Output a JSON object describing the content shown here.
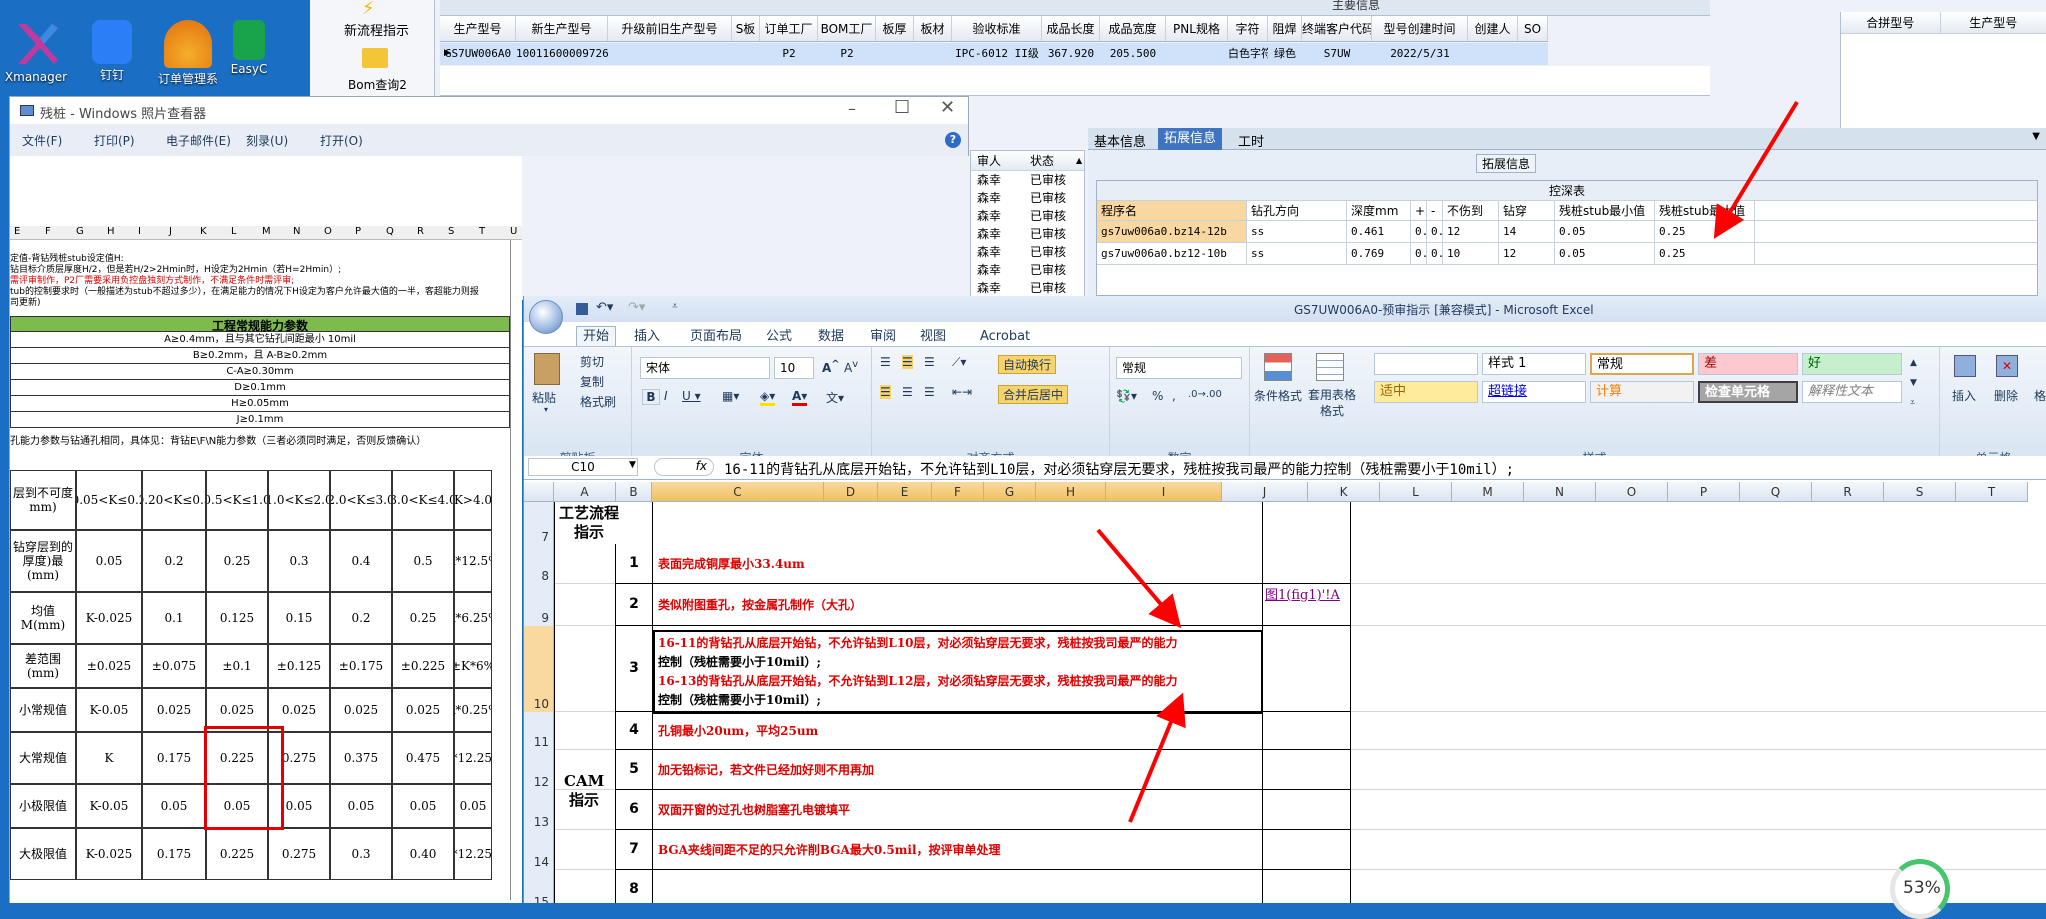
{
  "desktop": {
    "icons": [
      {
        "label": "Xmanager"
      },
      {
        "label": "钉钉"
      },
      {
        "label": "订单管理系"
      },
      {
        "label": "EasyC"
      }
    ],
    "top_labels": [
      "…"
    ]
  },
  "erp": {
    "left_buttons": [
      {
        "label": "新流程指示"
      },
      {
        "label": "Bom查询2"
      }
    ],
    "header_title": "主要信息",
    "columns": [
      "生产型号",
      "新生产型号",
      "升级前旧生产型号",
      "S板",
      "订单工厂",
      "BOM工厂",
      "板厚",
      "板材",
      "验收标准",
      "成品长度",
      "成品宽度",
      "PNL规格",
      "字符",
      "阻焊",
      "终端客户代码",
      "型号创建时间",
      "创建人",
      "SO"
    ],
    "row": [
      "GS7UW006A0",
      "10011600009726",
      "",
      "",
      "P2",
      "P2",
      "",
      "",
      "IPC-6012 II级",
      "367.920",
      "205.500",
      "",
      "白色字符",
      "绿色",
      "S7UW",
      "2022/5/31",
      "",
      ""
    ],
    "right_cols": [
      "合拼型号",
      "生产型号"
    ],
    "side_col_headers": [
      "审人",
      "状态"
    ],
    "side_rows": [
      [
        "森幸",
        "已审核"
      ],
      [
        "森幸",
        "已审核"
      ],
      [
        "森幸",
        "已审核"
      ],
      [
        "森幸",
        "已审核"
      ],
      [
        "森幸",
        "已审核"
      ],
      [
        "森幸",
        "已审核"
      ],
      [
        "森幸",
        "已审核"
      ]
    ],
    "tabs": [
      "基本信息",
      "拓展信息",
      "工时"
    ],
    "group_title": "拓展信息",
    "table_title": "控深表",
    "depth_cols": [
      "程序名",
      "钻孔方向",
      "深度mm",
      "+",
      "-",
      "不伤到",
      "钻穿",
      "残桩stub最小值",
      "残桩stub最大值"
    ],
    "depth_rows": [
      [
        "gs7uw006a0.bz14-12b",
        "ss",
        "0.461",
        "0..",
        "0..",
        "12",
        "14",
        "0.05",
        "0.25"
      ],
      [
        "gs7uw006a0.bz12-10b",
        "ss",
        "0.769",
        "0..",
        "0..",
        "10",
        "12",
        "0.05",
        "0.25"
      ]
    ]
  },
  "photo_viewer": {
    "title": "残桩 - Windows 照片查看器",
    "menu": [
      "文件(F)",
      "打印(P)",
      "电子邮件(E)",
      "刻录(U)",
      "打开(O)"
    ],
    "col_letters": [
      "E",
      "F",
      "G",
      "H",
      "I",
      "J",
      "K",
      "L",
      "M",
      "N",
      "O",
      "P",
      "Q",
      "R",
      "S",
      "T",
      "U"
    ],
    "notes": [
      "定值-背钻残桩stub设定值H:",
      "钻目标介质层厚度H/2，但是若H/2>2Hmin时，H设定为2Hmin（若H=2Hmin）;",
      "需评审制作，P2厂需要采用负控盘独刻方式制作，不满足条件时需评审;",
      "tub的控制要求时（一般描述为stub不超过多少），在满足能力的情况下H设定为客户允许最大值的一半，客超能力则报",
      "司更新)"
    ],
    "cap_title": "工程常规能力参数",
    "cap_rows": [
      "A≥0.4mm，且与其它钻孔间距最小 10mil",
      "B≥0.2mm，且 A-B≥0.2mm",
      "C-A≥0.30mm",
      "D≥0.1mm",
      "H≥0.05mm",
      "J≥0.1mm"
    ],
    "cap_note": "孔能力参数与钻通孔相同，具体见：背钻E\\F\\N能力参数（三者必须同时满足，否则反馈确认）",
    "k_headers": [
      "层到不可度mm)",
      "0.05<K≤0.2",
      "0.20<K≤0.5",
      "0.5<K≤1.0",
      "1.0<K≤2.0",
      "2.0<K≤3.0",
      "3.0<K≤4.0",
      "K>4.0"
    ],
    "k_rows": [
      [
        "钻穿层到的厚度)最(mm)",
        "0.05",
        "0.2",
        "0.25",
        "0.3",
        "0.4",
        "0.5",
        "K*12.5%"
      ],
      [
        "均值M(mm)",
        "K-0.025",
        "0.1",
        "0.125",
        "0.15",
        "0.2",
        "0.25",
        "K*6.25%"
      ],
      [
        "差范围(mm)",
        "±0.025",
        "±0.075",
        "±0.1",
        "±0.125",
        "±0.175",
        "±0.225",
        "±K*6%"
      ],
      [
        "小常规值",
        "K-0.05",
        "0.025",
        "0.025",
        "0.025",
        "0.025",
        "0.025",
        "K*0.25%"
      ],
      [
        "大常规值",
        "K",
        "0.175",
        "0.225",
        "0.275",
        "0.375",
        "0.475",
        "K*12.25%"
      ],
      [
        "小极限值",
        "K-0.05",
        "0.05",
        "0.05",
        "0.05",
        "0.05",
        "0.05",
        "0.05"
      ],
      [
        "大极限值",
        "K-0.025",
        "0.175",
        "0.225",
        "0.275",
        "0.3",
        "0.40",
        "K*12.25%"
      ]
    ]
  },
  "excel": {
    "title": "GS7UW006A0-预审指示  [兼容模式] - Microsoft Excel",
    "tabs": [
      "开始",
      "插入",
      "页面布局",
      "公式",
      "数据",
      "审阅",
      "视图",
      "Acrobat"
    ],
    "clipboard": {
      "paste": "粘贴",
      "cut": "剪切",
      "copy": "复制",
      "format_painter": "格式刷",
      "label": "剪贴板"
    },
    "font": {
      "name": "宋体",
      "size": "10",
      "label": "字体"
    },
    "align": {
      "wrap": "自动换行",
      "merge": "合并后居中",
      "label": "对齐方式"
    },
    "number": {
      "format": "常规",
      "label": "数字"
    },
    "styles": {
      "cond": "条件格式",
      "table": "套用表格格式",
      "label": "样式",
      "cells": [
        "",
        "样式 1",
        "常规",
        "差",
        "好",
        "适中",
        "超链接",
        "计算",
        "检查单元格",
        "解释性文本"
      ]
    },
    "cells_group": {
      "insert": "插入",
      "delete": "删除",
      "format": "格式",
      "label": "单元格"
    },
    "name_box": "C10",
    "formula": "16-11的背钻孔从底层开始钻，不允许钻到L10层，对必须钻穿层无要求，残桩按我司最严的能力控制（残桩需要小于10mil）;",
    "columns": [
      "A",
      "B",
      "C",
      "D",
      "E",
      "F",
      "G",
      "H",
      "I",
      "J",
      "K",
      "L",
      "M",
      "N",
      "O",
      "P",
      "Q",
      "R",
      "S",
      "T"
    ],
    "a7": "工艺流程指示",
    "a_cam": "CAM指示",
    "rows": [
      {
        "rn": "8",
        "num": "1",
        "text": "表面完成铜厚最小33.4um"
      },
      {
        "rn": "9",
        "num": "2",
        "text": "类似附图重孔，按金属孔制作（大孔）",
        "link": "图1(fig1)'!A"
      },
      {
        "rn": "10",
        "num": "3",
        "lines": [
          "16-11的背钻孔从底层开始钻，不允许钻到L10层，对必须钻穿层无要求，残桩按我司最严的能力",
          "控制（残桩需要小于10mil）;",
          "16-13的背钻孔从底层开始钻，不允许钻到L12层，对必须钻穿层无要求，残桩按我司最严的能力",
          "控制（残桩需要小于10mil）;"
        ]
      },
      {
        "rn": "11",
        "num": "4",
        "text": "孔铜最小20um，平均25um"
      },
      {
        "rn": "12",
        "num": "5",
        "text": "加无铅标记，若文件已经加好则不用再加"
      },
      {
        "rn": "13",
        "num": "6",
        "text": "双面开窗的过孔也树脂塞孔电镀填平"
      },
      {
        "rn": "14",
        "num": "7",
        "text": "BGA夹线间距不足的只允许削BGA最大0.5mil，按评审单处理"
      },
      {
        "rn": "15",
        "num": "8",
        "text": ""
      }
    ],
    "row7": "7",
    "progress": "53%"
  },
  "colors": {
    "accent_red": "#ff0000",
    "excel_blue": "#1e395b"
  }
}
